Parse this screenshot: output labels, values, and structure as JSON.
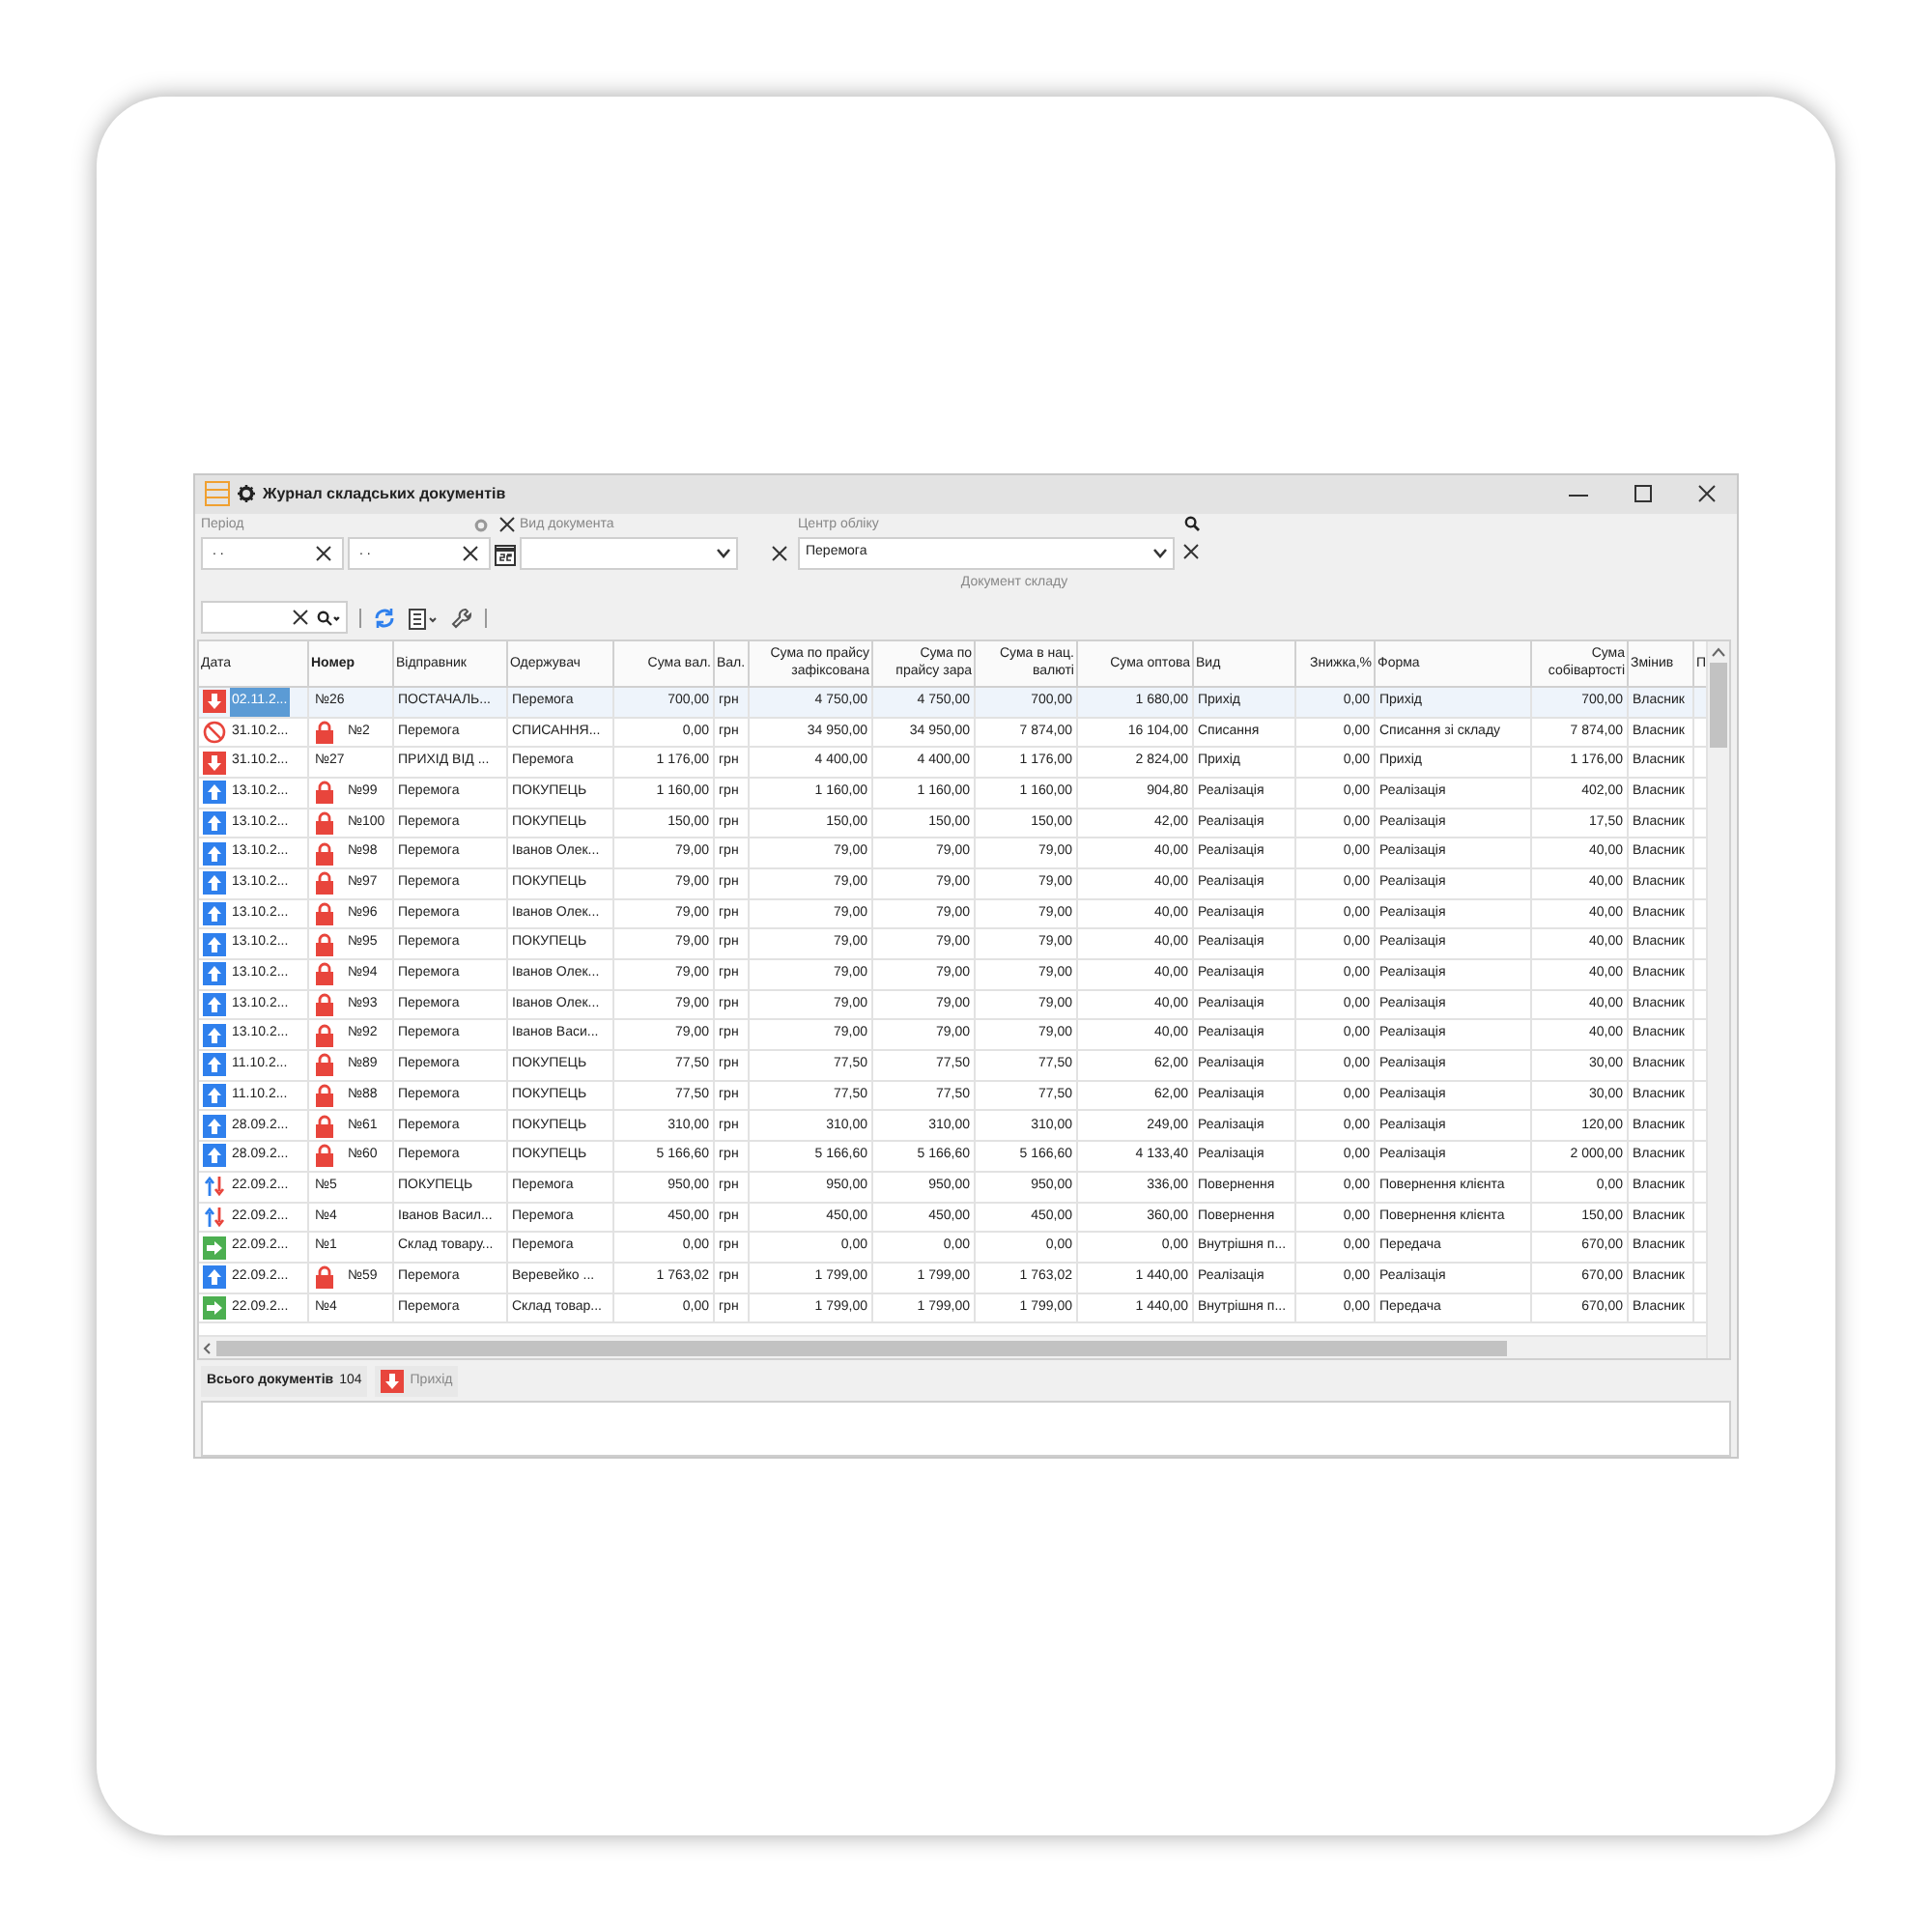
{
  "window": {
    "title": "Журнал складських документів"
  },
  "filters": {
    "period_label": "Період",
    "date_from": ". .",
    "date_to": ". .",
    "doc_type_label": "Вид документа",
    "center_label": "Центр обліку",
    "center_value": "Перемога",
    "caption": "Документ складу"
  },
  "table": {
    "columns": [
      "Дата",
      "Номер",
      "Відправник",
      "Одержувач",
      "Сума вал.",
      "Вал.",
      "Сума по прайсу зафіксована",
      "Сума по прайсу зара",
      "Сума в нац. валюті",
      "Сума оптова",
      "Вид",
      "Знижка,%",
      "Форма",
      "Сума собівартості",
      "Змінив",
      "П"
    ],
    "rows": [
      {
        "kind": "in",
        "locked": false,
        "selected": true,
        "cells": [
          "02.11.2...",
          "№26",
          "ПОСТАЧАЛЬ...",
          "Перемога",
          "700,00",
          "грн",
          "4 750,00",
          "4 750,00",
          "700,00",
          "1 680,00",
          "Прихід",
          "0,00",
          "Прихід",
          "700,00",
          "Власник"
        ]
      },
      {
        "kind": "writeoff",
        "locked": true,
        "selected": false,
        "cells": [
          "31.10.2...",
          "№2",
          "Перемога",
          "СПИСАННЯ...",
          "0,00",
          "грн",
          "34 950,00",
          "34 950,00",
          "7 874,00",
          "16 104,00",
          "Списання",
          "0,00",
          "Списання зі складу",
          "7 874,00",
          "Власник"
        ]
      },
      {
        "kind": "in",
        "locked": false,
        "selected": false,
        "cells": [
          "31.10.2...",
          "№27",
          "ПРИХІД ВІД ...",
          "Перемога",
          "1 176,00",
          "грн",
          "4 400,00",
          "4 400,00",
          "1 176,00",
          "2 824,00",
          "Прихід",
          "0,00",
          "Прихід",
          "1 176,00",
          "Власник"
        ]
      },
      {
        "kind": "out",
        "locked": true,
        "selected": false,
        "cells": [
          "13.10.2...",
          "№99",
          "Перемога",
          "ПОКУПЕЦЬ",
          "1 160,00",
          "грн",
          "1 160,00",
          "1 160,00",
          "1 160,00",
          "904,80",
          "Реалізація",
          "0,00",
          "Реалізація",
          "402,00",
          "Власник"
        ]
      },
      {
        "kind": "out",
        "locked": true,
        "selected": false,
        "cells": [
          "13.10.2...",
          "№100",
          "Перемога",
          "ПОКУПЕЦЬ",
          "150,00",
          "грн",
          "150,00",
          "150,00",
          "150,00",
          "42,00",
          "Реалізація",
          "0,00",
          "Реалізація",
          "17,50",
          "Власник"
        ]
      },
      {
        "kind": "out",
        "locked": true,
        "selected": false,
        "cells": [
          "13.10.2...",
          "№98",
          "Перемога",
          "Іванов Олек...",
          "79,00",
          "грн",
          "79,00",
          "79,00",
          "79,00",
          "40,00",
          "Реалізація",
          "0,00",
          "Реалізація",
          "40,00",
          "Власник"
        ]
      },
      {
        "kind": "out",
        "locked": true,
        "selected": false,
        "cells": [
          "13.10.2...",
          "№97",
          "Перемога",
          "ПОКУПЕЦЬ",
          "79,00",
          "грн",
          "79,00",
          "79,00",
          "79,00",
          "40,00",
          "Реалізація",
          "0,00",
          "Реалізація",
          "40,00",
          "Власник"
        ]
      },
      {
        "kind": "out",
        "locked": true,
        "selected": false,
        "cells": [
          "13.10.2...",
          "№96",
          "Перемога",
          "Іванов Олек...",
          "79,00",
          "грн",
          "79,00",
          "79,00",
          "79,00",
          "40,00",
          "Реалізація",
          "0,00",
          "Реалізація",
          "40,00",
          "Власник"
        ]
      },
      {
        "kind": "out",
        "locked": true,
        "selected": false,
        "cells": [
          "13.10.2...",
          "№95",
          "Перемога",
          "ПОКУПЕЦЬ",
          "79,00",
          "грн",
          "79,00",
          "79,00",
          "79,00",
          "40,00",
          "Реалізація",
          "0,00",
          "Реалізація",
          "40,00",
          "Власник"
        ]
      },
      {
        "kind": "out",
        "locked": true,
        "selected": false,
        "cells": [
          "13.10.2...",
          "№94",
          "Перемога",
          "Іванов Олек...",
          "79,00",
          "грн",
          "79,00",
          "79,00",
          "79,00",
          "40,00",
          "Реалізація",
          "0,00",
          "Реалізація",
          "40,00",
          "Власник"
        ]
      },
      {
        "kind": "out",
        "locked": true,
        "selected": false,
        "cells": [
          "13.10.2...",
          "№93",
          "Перемога",
          "Іванов Олек...",
          "79,00",
          "грн",
          "79,00",
          "79,00",
          "79,00",
          "40,00",
          "Реалізація",
          "0,00",
          "Реалізація",
          "40,00",
          "Власник"
        ]
      },
      {
        "kind": "out",
        "locked": true,
        "selected": false,
        "cells": [
          "13.10.2...",
          "№92",
          "Перемога",
          "Іванов Васи...",
          "79,00",
          "грн",
          "79,00",
          "79,00",
          "79,00",
          "40,00",
          "Реалізація",
          "0,00",
          "Реалізація",
          "40,00",
          "Власник"
        ]
      },
      {
        "kind": "out",
        "locked": true,
        "selected": false,
        "cells": [
          "11.10.2...",
          "№89",
          "Перемога",
          "ПОКУПЕЦЬ",
          "77,50",
          "грн",
          "77,50",
          "77,50",
          "77,50",
          "62,00",
          "Реалізація",
          "0,00",
          "Реалізація",
          "30,00",
          "Власник"
        ]
      },
      {
        "kind": "out",
        "locked": true,
        "selected": false,
        "cells": [
          "11.10.2...",
          "№88",
          "Перемога",
          "ПОКУПЕЦЬ",
          "77,50",
          "грн",
          "77,50",
          "77,50",
          "77,50",
          "62,00",
          "Реалізація",
          "0,00",
          "Реалізація",
          "30,00",
          "Власник"
        ]
      },
      {
        "kind": "out",
        "locked": true,
        "selected": false,
        "cells": [
          "28.09.2...",
          "№61",
          "Перемога",
          "ПОКУПЕЦЬ",
          "310,00",
          "грн",
          "310,00",
          "310,00",
          "310,00",
          "249,00",
          "Реалізація",
          "0,00",
          "Реалізація",
          "120,00",
          "Власник"
        ]
      },
      {
        "kind": "out",
        "locked": true,
        "selected": false,
        "cells": [
          "28.09.2...",
          "№60",
          "Перемога",
          "ПОКУПЕЦЬ",
          "5 166,60",
          "грн",
          "5 166,60",
          "5 166,60",
          "5 166,60",
          "4 133,40",
          "Реалізація",
          "0,00",
          "Реалізація",
          "2 000,00",
          "Власник"
        ]
      },
      {
        "kind": "return",
        "locked": false,
        "selected": false,
        "cells": [
          "22.09.2...",
          "№5",
          "ПОКУПЕЦЬ",
          "Перемога",
          "950,00",
          "грн",
          "950,00",
          "950,00",
          "950,00",
          "336,00",
          "Повернення",
          "0,00",
          "Повернення клієнта",
          "0,00",
          "Власник"
        ]
      },
      {
        "kind": "return",
        "locked": false,
        "selected": false,
        "cells": [
          "22.09.2...",
          "№4",
          "Іванов Васил...",
          "Перемога",
          "450,00",
          "грн",
          "450,00",
          "450,00",
          "450,00",
          "360,00",
          "Повернення",
          "0,00",
          "Повернення клієнта",
          "150,00",
          "Власник"
        ]
      },
      {
        "kind": "transfer",
        "locked": false,
        "selected": false,
        "cells": [
          "22.09.2...",
          "№1",
          "Склад товару...",
          "Перемога",
          "0,00",
          "грн",
          "0,00",
          "0,00",
          "0,00",
          "0,00",
          "Внутрішня п...",
          "0,00",
          "Передача",
          "670,00",
          "Власник"
        ]
      },
      {
        "kind": "out",
        "locked": true,
        "selected": false,
        "cells": [
          "22.09.2...",
          "№59",
          "Перемога",
          "Веревейко ...",
          "1 763,02",
          "грн",
          "1 799,00",
          "1 799,00",
          "1 763,02",
          "1 440,00",
          "Реалізація",
          "0,00",
          "Реалізація",
          "670,00",
          "Власник"
        ]
      },
      {
        "kind": "transfer",
        "locked": false,
        "selected": false,
        "cells": [
          "22.09.2...",
          "№4",
          "Перемога",
          "Склад товар...",
          "0,00",
          "грн",
          "1 799,00",
          "1 799,00",
          "1 799,00",
          "1 440,00",
          "Внутрішня п...",
          "0,00",
          "Передача",
          "670,00",
          "Власник"
        ]
      }
    ]
  },
  "footer": {
    "total_label": "Всього документів",
    "total_count": "104",
    "tabs": [
      {
        "label": "Прихід",
        "kind": "in",
        "selected": false
      }
    ]
  }
}
